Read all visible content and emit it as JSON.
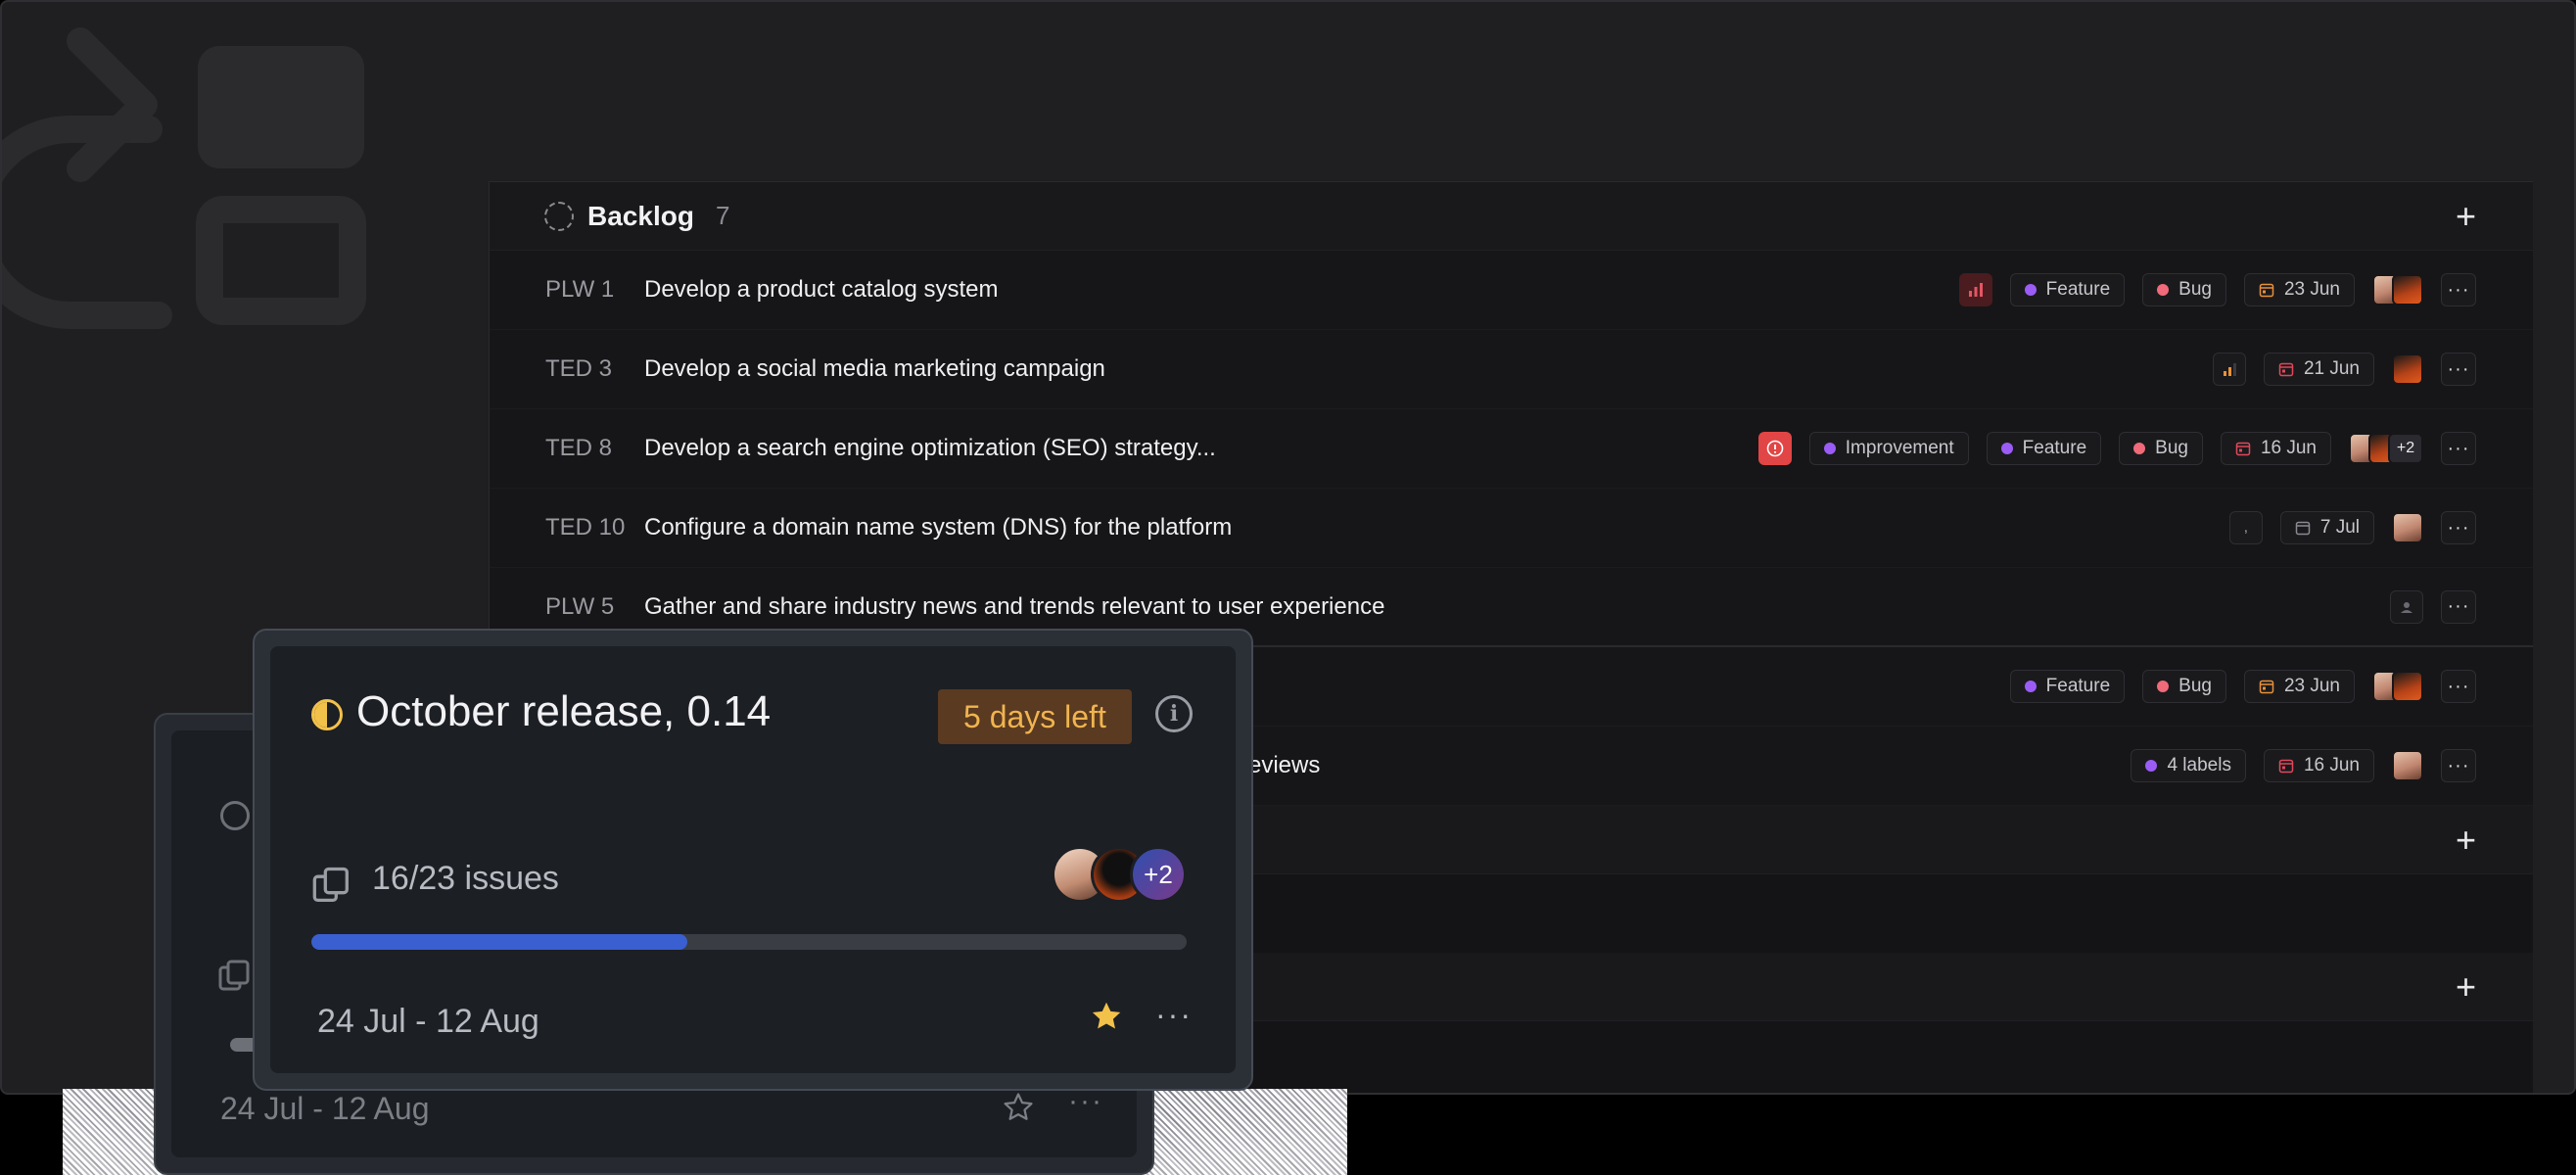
{
  "backlog": {
    "title": "Backlog",
    "count": "7",
    "rows": [
      {
        "id": "PLW 1",
        "title": "Develop a product catalog system",
        "labels": [
          "Feature",
          "Bug"
        ],
        "date": "23 Jun"
      },
      {
        "id": "TED 3",
        "title": "Develop a social media marketing campaign",
        "labels": [],
        "date": "21 Jun"
      },
      {
        "id": "TED 8",
        "title": "Develop a search engine optimization (SEO) strategy...",
        "labels": [
          "Improvement",
          "Feature",
          "Bug"
        ],
        "date": "16 Jun",
        "extra_assignees": "+2"
      },
      {
        "id": "TED 10",
        "title": "Configure a domain name system (DNS) for the platform",
        "labels": [],
        "date": "7 Jul"
      },
      {
        "id": "PLW 5",
        "title": "Gather and share industry news and trends relevant to user experience",
        "labels": [],
        "date": ""
      }
    ],
    "partial_rows": [
      {
        "labels": [
          "Feature",
          "Bug"
        ],
        "date": "23 Jun"
      },
      {
        "title_fragment": "eviews",
        "labels_count": "4 labels",
        "date": "16 Jun"
      }
    ]
  },
  "colors": {
    "feature": "#9b5cf6",
    "bug": "#f06a7a",
    "improvement": "#9b5cf6",
    "labels": "#9b5cf6",
    "cycle_accent": "#f2c14a",
    "progress": "#3a5fd0",
    "urgent": "#e24545"
  },
  "cycle_card": {
    "title": "October release, 0.14",
    "badge": "5 days left",
    "issues": "16/23 issues",
    "progress": 0.43,
    "extra_members": "+2",
    "dates": "24 Jul - 12 Aug",
    "favorited": true
  },
  "cycle_card_back": {
    "dates": "24 Jul - 12 Aug",
    "favorited": false
  },
  "icons": {
    "info": "i"
  }
}
